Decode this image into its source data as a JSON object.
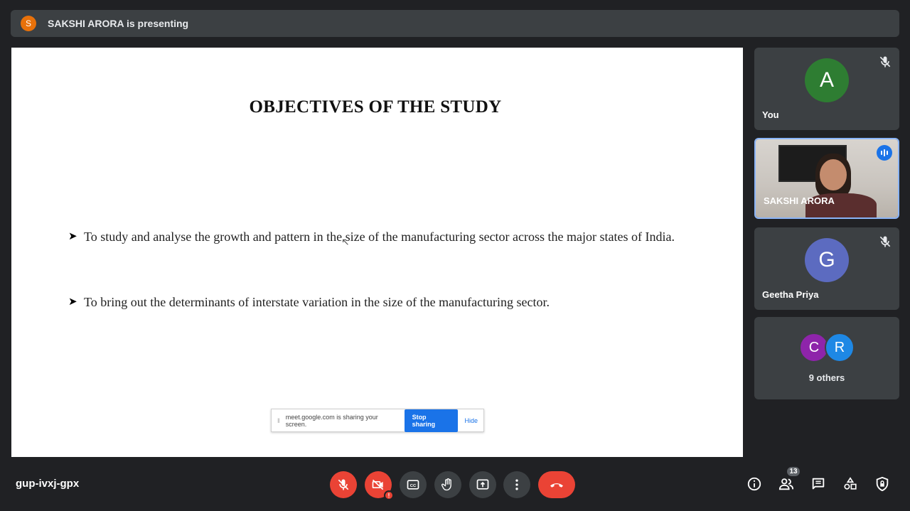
{
  "presenter_bar": {
    "avatar_letter": "S",
    "text": "SAKSHI ARORA is presenting"
  },
  "slide": {
    "title": "OBJECTIVES OF THE STUDY",
    "bullets": [
      "To study and analyse the growth and pattern in the size of the manufacturing sector across the major states of India.",
      "To bring out the determinants of interstate variation in the size of the manufacturing sector."
    ]
  },
  "share_popup": {
    "message": "meet.google.com is sharing your screen.",
    "stop_label": "Stop sharing",
    "hide_label": "Hide"
  },
  "participants": {
    "you": {
      "letter": "A",
      "name": "You",
      "color": "#2e7d32"
    },
    "presenter": {
      "name": "SAKSHI ARORA"
    },
    "geetha": {
      "letter": "G",
      "name": "Geetha Priya",
      "color": "#5c6bc0"
    },
    "others": {
      "letters": [
        "C",
        "R"
      ],
      "colors": [
        "#8e24aa",
        "#1e88e5"
      ],
      "label": "9 others"
    }
  },
  "footer": {
    "meeting_code": "gup-ivxj-gpx",
    "participant_count": "13"
  },
  "icons": [
    "mic-off-icon",
    "camera-off-icon",
    "captions-icon",
    "raise-hand-icon",
    "present-icon",
    "more-icon",
    "end-call-icon",
    "info-icon",
    "people-icon",
    "chat-icon",
    "activities-icon",
    "host-controls-icon"
  ]
}
